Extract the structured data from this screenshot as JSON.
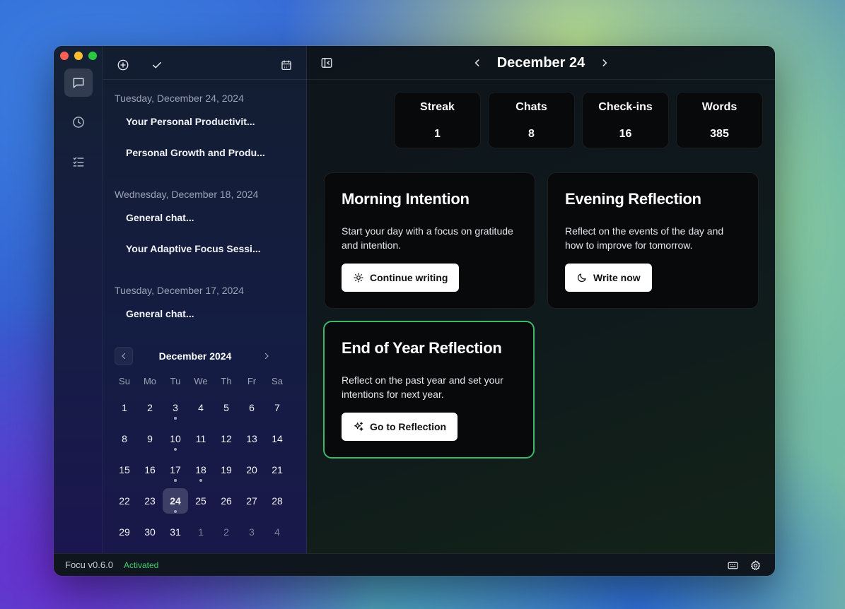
{
  "sidebar": {
    "groups": [
      {
        "date": "Tuesday, December 24, 2024",
        "items": [
          "Your Personal Productivit...",
          "Personal Growth and Produ..."
        ]
      },
      {
        "date": "Wednesday, December 18, 2024",
        "items": [
          "General chat...",
          "Your Adaptive Focus Sessi..."
        ]
      },
      {
        "date": "Tuesday, December 17, 2024",
        "items": [
          "General chat..."
        ]
      }
    ]
  },
  "calendar": {
    "title": "December 2024",
    "weekdays": [
      "Su",
      "Mo",
      "Tu",
      "We",
      "Th",
      "Fr",
      "Sa"
    ],
    "days": [
      {
        "n": "1"
      },
      {
        "n": "2"
      },
      {
        "n": "3",
        "dot": true
      },
      {
        "n": "4"
      },
      {
        "n": "5"
      },
      {
        "n": "6"
      },
      {
        "n": "7"
      },
      {
        "n": "8"
      },
      {
        "n": "9"
      },
      {
        "n": "10",
        "dot": true
      },
      {
        "n": "11"
      },
      {
        "n": "12"
      },
      {
        "n": "13"
      },
      {
        "n": "14"
      },
      {
        "n": "15"
      },
      {
        "n": "16"
      },
      {
        "n": "17",
        "dot": true
      },
      {
        "n": "18",
        "dot": true
      },
      {
        "n": "19"
      },
      {
        "n": "20"
      },
      {
        "n": "21"
      },
      {
        "n": "22"
      },
      {
        "n": "23"
      },
      {
        "n": "24",
        "dot": true,
        "selected": true
      },
      {
        "n": "25"
      },
      {
        "n": "26"
      },
      {
        "n": "27"
      },
      {
        "n": "28"
      },
      {
        "n": "29"
      },
      {
        "n": "30"
      },
      {
        "n": "31"
      },
      {
        "n": "1",
        "other": true
      },
      {
        "n": "2",
        "other": true
      },
      {
        "n": "3",
        "other": true
      },
      {
        "n": "4",
        "other": true
      }
    ]
  },
  "header": {
    "title": "December 24"
  },
  "stats": [
    {
      "label": "Streak",
      "value": "1"
    },
    {
      "label": "Chats",
      "value": "8"
    },
    {
      "label": "Check-ins",
      "value": "16"
    },
    {
      "label": "Words",
      "value": "385"
    }
  ],
  "cards": {
    "morning": {
      "title": "Morning Intention",
      "desc": "Start your day with a focus on gratitude and intention.",
      "button": "Continue writing",
      "icon": "sun-icon"
    },
    "evening": {
      "title": "Evening Reflection",
      "desc": "Reflect on the events of the day and how to improve for tomorrow.",
      "button": "Write now",
      "icon": "moon-icon"
    },
    "year": {
      "title": "End of Year Reflection",
      "desc": "Reflect on the past year and set your intentions for next year.",
      "button": "Go to Reflection",
      "icon": "sparkles-icon"
    }
  },
  "status": {
    "version": "Focu v0.6.0",
    "activation": "Activated",
    "accent": "#3fcf6e"
  },
  "colors": {
    "highlight_border": "#3fb86b"
  }
}
